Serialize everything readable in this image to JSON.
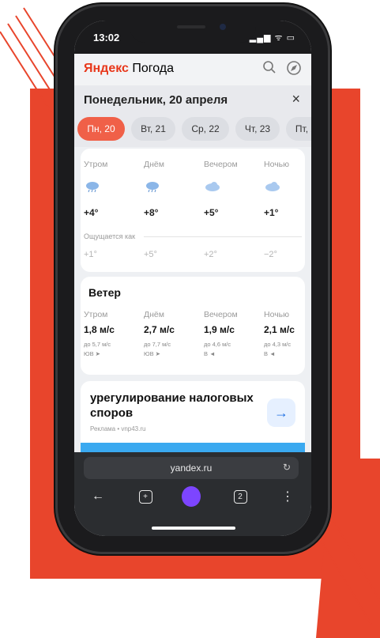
{
  "status": {
    "time": "13:02",
    "icons": "▂▄▆ ᯤ ▭"
  },
  "app": {
    "logo_brand": "Яндекс",
    "logo_name": " Погода",
    "search_icon": "search-icon",
    "location_icon": "compass-icon"
  },
  "day_header": {
    "title": "Понедельник, 20 апреля",
    "close": "×"
  },
  "tabs": [
    {
      "label": "Пн, 20",
      "active": true
    },
    {
      "label": "Вт, 21"
    },
    {
      "label": "Ср, 22"
    },
    {
      "label": "Чт, 23"
    },
    {
      "label": "Пт, 2"
    }
  ],
  "forecast": {
    "periods": [
      "Утром",
      "Днём",
      "Вечером",
      "Ночью"
    ],
    "icons": [
      "rain-cloud-icon",
      "rain-cloud-icon",
      "cloud-icon",
      "cloud-icon"
    ],
    "temps": [
      "+4°",
      "+8°",
      "+5°",
      "+1°"
    ],
    "feels_label": "Ощущается как",
    "feels": [
      "+1°",
      "+5°",
      "+2°",
      "−2°"
    ]
  },
  "wind": {
    "title": "Ветер",
    "periods": [
      "Утром",
      "Днём",
      "Вечером",
      "Ночью"
    ],
    "speeds": [
      "1,8 м/с",
      "2,7 м/с",
      "1,9 м/с",
      "2,1 м/с"
    ],
    "gusts": [
      "до 5,7 м/с",
      "до 7,7 м/с",
      "до 4,6 м/с",
      "до 4,3 м/с"
    ],
    "dirs": [
      "ЮВ ➤",
      "ЮВ ➤",
      "В ◄",
      "В ◄"
    ]
  },
  "ad": {
    "title": "урегулирование налоговых споров",
    "source": "Реклама • vnp43.ru",
    "arrow": "→"
  },
  "browser": {
    "url": "yandex.ru",
    "reload": "↻",
    "back": "←",
    "tabs_count": "2",
    "menu": "⋮"
  },
  "colors": {
    "accent": "#f06048",
    "deco_red": "#e8452c",
    "alice": "#7d45ff"
  }
}
